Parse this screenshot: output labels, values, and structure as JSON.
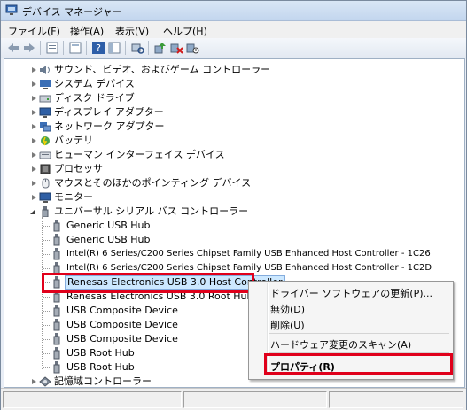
{
  "window": {
    "title": "デバイス マネージャー"
  },
  "menu": [
    {
      "label": "ファイル(F)"
    },
    {
      "label": "操作(A)"
    },
    {
      "label": "表示(V)"
    },
    {
      "label": "ヘルプ(H)"
    }
  ],
  "tree": {
    "categories_top": [
      {
        "label": "サウンド、ビデオ、およびゲーム コントローラー",
        "icon": "speaker-icon"
      },
      {
        "label": "システム デバイス",
        "icon": "system-icon"
      },
      {
        "label": "ディスク ドライブ",
        "icon": "disk-icon"
      },
      {
        "label": "ディスプレイ アダプター",
        "icon": "display-icon"
      },
      {
        "label": "ネットワーク アダプター",
        "icon": "network-icon"
      },
      {
        "label": "バッテリ",
        "icon": "battery-icon"
      },
      {
        "label": "ヒューマン インターフェイス デバイス",
        "icon": "hid-icon"
      },
      {
        "label": "プロセッサ",
        "icon": "processor-icon"
      },
      {
        "label": "マウスとそのほかのポインティング デバイス",
        "icon": "mouse-icon"
      },
      {
        "label": "モニター",
        "icon": "monitor-icon"
      }
    ],
    "usb_category": {
      "label": "ユニバーサル シリアル バス コントローラー",
      "icon": "usb-controller-icon"
    },
    "usb_children": [
      {
        "label": "Generic USB Hub"
      },
      {
        "label": "Generic USB Hub"
      },
      {
        "label": "Intel(R) 6 Series/C200 Series Chipset Family USB Enhanced Host Controller - 1C26"
      },
      {
        "label": "Intel(R) 6 Series/C200 Series Chipset Family USB Enhanced Host Controller - 1C2D"
      },
      {
        "label": "Renesas Electronics USB 3.0 Host Controller"
      },
      {
        "label": "Renesas Electronics USB 3.0 Root Hub"
      },
      {
        "label": "USB Composite Device"
      },
      {
        "label": "USB Composite Device"
      },
      {
        "label": "USB Composite Device"
      },
      {
        "label": "USB Root Hub"
      },
      {
        "label": "USB Root Hub"
      }
    ],
    "last_category": {
      "label": "記憶域コントローラー",
      "icon": "storage-icon"
    }
  },
  "context_menu": {
    "items": [
      {
        "label": "ドライバー ソフトウェアの更新(P)..."
      },
      {
        "label": "無効(D)"
      },
      {
        "label": "削除(U)"
      },
      {
        "label": "ハードウェア変更のスキャン(A)"
      },
      {
        "label": "プロパティ(R)"
      }
    ]
  },
  "colors": {
    "highlight_border": "#e0001b",
    "selection": "#cce8ff"
  }
}
